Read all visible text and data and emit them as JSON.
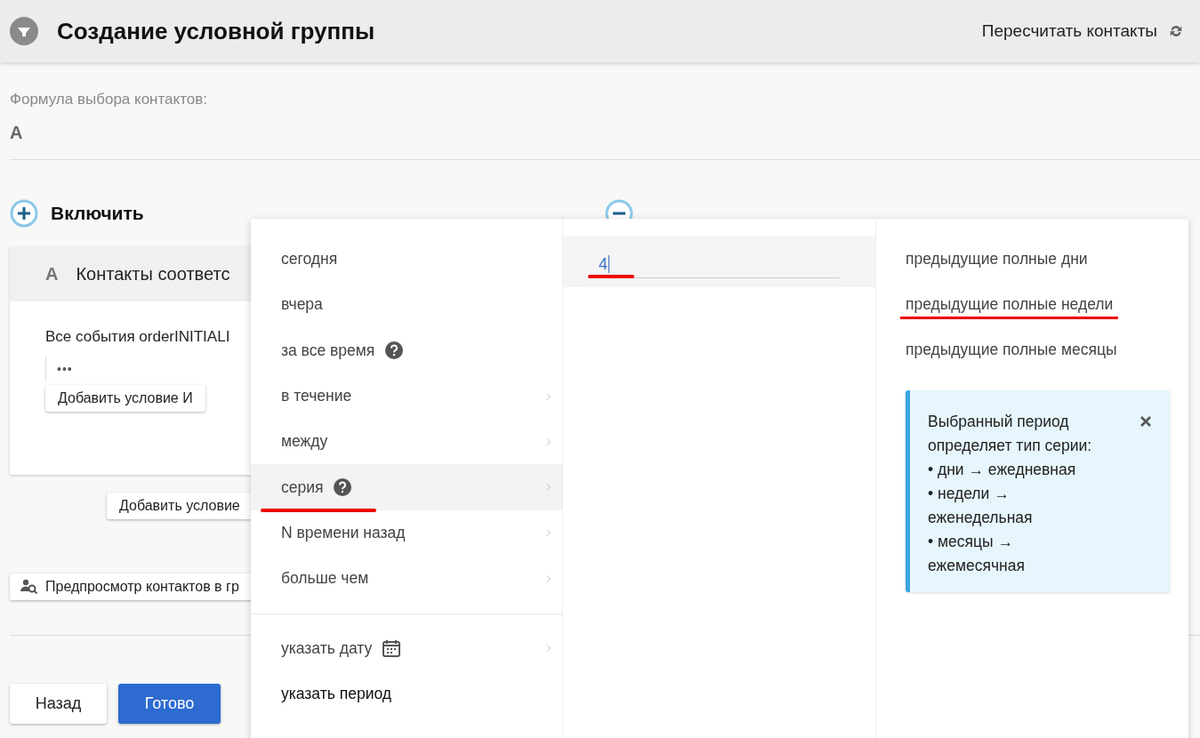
{
  "header": {
    "title": "Создание условной группы",
    "recount_label": "Пересчитать контакты"
  },
  "formula": {
    "label": "Формула выбора контактов:",
    "value": "A"
  },
  "include": {
    "title": "Включить",
    "card": {
      "letter": "A",
      "title": "Контакты соответс",
      "event_text": "Все события orderINITIALI",
      "dots": "•••",
      "add_and_button": "Добавить условие И"
    },
    "add_condition_button": "Добавить условие",
    "preview_button": "Предпросмотр контактов в гр"
  },
  "footer": {
    "buttons": [
      {
        "label": "Назад",
        "kind": "secondary"
      },
      {
        "label": "Готово",
        "kind": "primary"
      }
    ]
  },
  "popup": {
    "period_options": [
      {
        "label": "сегодня",
        "selected": false,
        "help": false,
        "submenu": false,
        "calendar": false,
        "underlined": false
      },
      {
        "label": "вчера",
        "selected": false,
        "help": false,
        "submenu": false,
        "calendar": false,
        "underlined": false
      },
      {
        "label": "за все время",
        "selected": false,
        "help": true,
        "submenu": false,
        "calendar": false,
        "underlined": false
      },
      {
        "label": "в течение",
        "selected": false,
        "help": false,
        "submenu": true,
        "calendar": false,
        "underlined": false
      },
      {
        "label": "между",
        "selected": false,
        "help": false,
        "submenu": true,
        "calendar": false,
        "underlined": false
      },
      {
        "label": "серия",
        "selected": true,
        "help": true,
        "submenu": true,
        "calendar": false,
        "underlined": true
      },
      {
        "label": "N времени назад",
        "selected": false,
        "help": false,
        "submenu": true,
        "calendar": false,
        "underlined": false
      },
      {
        "label": "больше чем",
        "selected": false,
        "help": false,
        "submenu": true,
        "calendar": false,
        "underlined": false
      }
    ],
    "extra_options": [
      {
        "label": "указать дату",
        "selected": false,
        "help": false,
        "submenu": true,
        "calendar": true,
        "underlined": false
      },
      {
        "label": "указать период",
        "selected": false,
        "help": false,
        "submenu": false,
        "calendar": false,
        "underlined": false
      }
    ],
    "count": {
      "value": "4",
      "underlined": true
    },
    "unit_options": [
      {
        "label": "предыдущие полные дни",
        "underlined": false
      },
      {
        "label": "предыдущие полные недели",
        "underlined": true
      },
      {
        "label": "предыдущие полные месяцы",
        "underlined": false
      }
    ],
    "info": {
      "lines": [
        "Выбранный период",
        "определяет тип серии:",
        "• дни → ежедневная",
        "• недели →",
        "еженедельная",
        "• месяцы →",
        "ежемесячная"
      ]
    }
  }
}
